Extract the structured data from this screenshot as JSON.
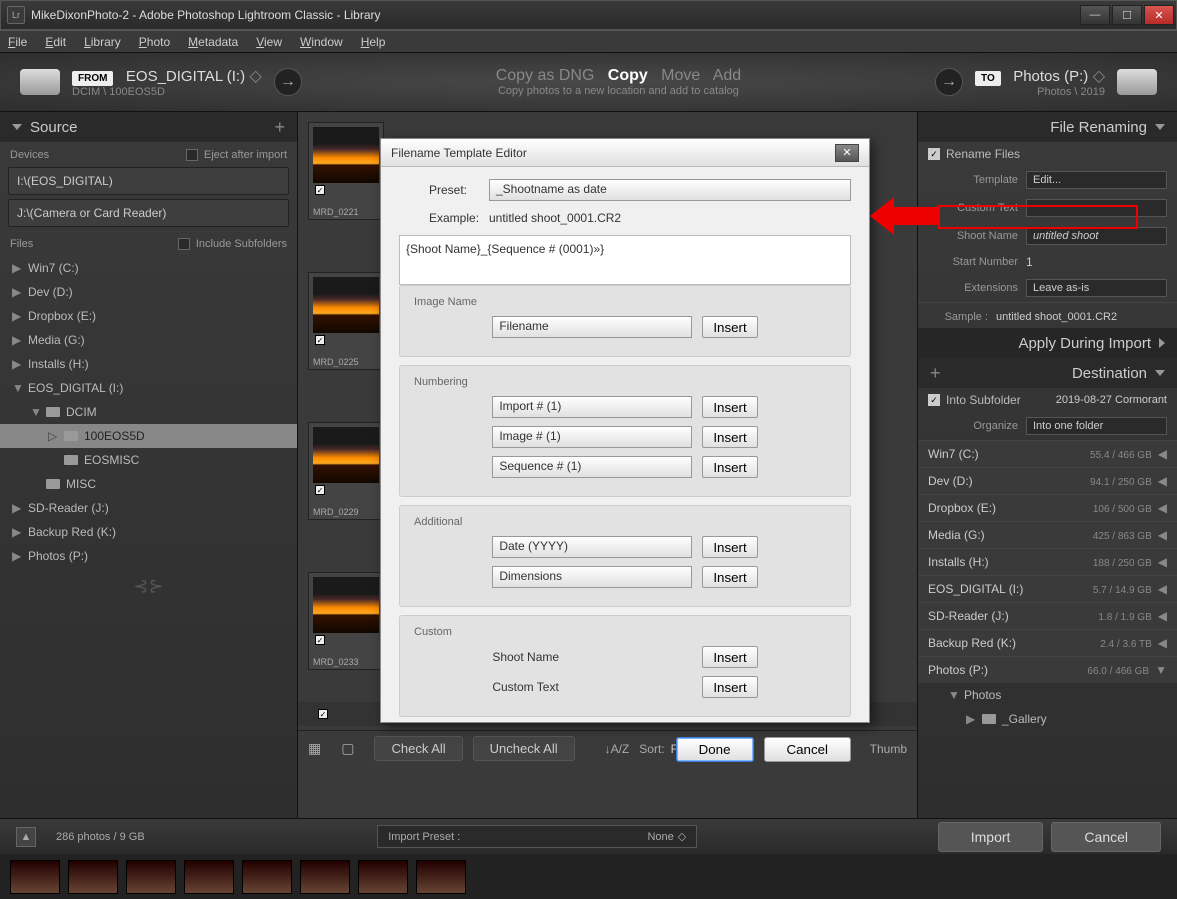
{
  "window": {
    "title": "MikeDixonPhoto-2 - Adobe Photoshop Lightroom Classic - Library"
  },
  "menu": [
    "File",
    "Edit",
    "Library",
    "Photo",
    "Metadata",
    "View",
    "Window",
    "Help"
  ],
  "import": {
    "from_label": "FROM",
    "from_drive": "EOS_DIGITAL (I:)",
    "from_path": "DCIM \\ 100EOS5D",
    "modes": [
      "Copy as DNG",
      "Copy",
      "Move",
      "Add"
    ],
    "desc": "Copy photos to a new location and add to catalog",
    "to_label": "TO",
    "to_drive": "Photos (P:)",
    "to_path": "Photos \\ 2019"
  },
  "source": {
    "header": "Source",
    "devices_label": "Devices",
    "eject": "Eject after import",
    "devices": [
      "I:\\(EOS_DIGITAL)",
      "J:\\(Camera or Card Reader)"
    ],
    "files_label": "Files",
    "include_sub": "Include Subfolders",
    "drives": [
      "Win7 (C:)",
      "Dev (D:)",
      "Dropbox (E:)",
      "Media (G:)",
      "Installs (H:)"
    ],
    "selected_drive": "EOS_DIGITAL (I:)",
    "tree": [
      "DCIM",
      "100EOS5D",
      "EOSMISC",
      "MISC"
    ],
    "drives2": [
      "SD-Reader (J:)",
      "Backup Red (K:)",
      "Photos (P:)"
    ]
  },
  "thumbs": [
    "MRD_0221",
    "MRD_0225",
    "MRD_0229",
    "MRD_0233"
  ],
  "toolbar": {
    "checkall": "Check All",
    "uncheckall": "Uncheck All",
    "sort_label": "Sort:",
    "sort_value": "File Name",
    "thumb": "Thumb"
  },
  "renaming": {
    "header": "File Renaming",
    "rename": "Rename Files",
    "template_label": "Template",
    "template_value": "Edit...",
    "custom_label": "Custom Text",
    "shoot_label": "Shoot Name",
    "shoot_value": "untitled shoot",
    "start_label": "Start Number",
    "start_value": "1",
    "ext_label": "Extensions",
    "ext_value": "Leave as-is",
    "sample_label": "Sample :",
    "sample_value": "untitled shoot_0001.CR2"
  },
  "apply": {
    "header": "Apply During Import"
  },
  "dest": {
    "header": "Destination",
    "into_sub": "Into Subfolder",
    "sub_value": "2019-08-27 Cormorant",
    "org_label": "Organize",
    "org_value": "Into one folder",
    "drives": [
      {
        "name": "Win7 (C:)",
        "size": "55.4 / 466 GB"
      },
      {
        "name": "Dev (D:)",
        "size": "94.1 / 250 GB"
      },
      {
        "name": "Dropbox (E:)",
        "size": "106 / 500 GB"
      },
      {
        "name": "Media (G:)",
        "size": "425 / 863 GB"
      },
      {
        "name": "Installs (H:)",
        "size": "188 / 250 GB"
      },
      {
        "name": "EOS_DIGITAL (I:)",
        "size": "5.7 / 14.9 GB"
      },
      {
        "name": "SD-Reader (J:)",
        "size": "1.8 / 1.9 GB"
      },
      {
        "name": "Backup Red (K:)",
        "size": "2.4 / 3.6 TB"
      },
      {
        "name": "Photos (P:)",
        "size": "66.0 / 466 GB"
      }
    ],
    "tree": [
      "Photos",
      "_Gallery"
    ]
  },
  "footer": {
    "count": "286 photos / 9 GB",
    "preset_label": "Import Preset :",
    "preset_value": "None",
    "import": "Import",
    "cancel": "Cancel"
  },
  "dialog": {
    "title": "Filename Template Editor",
    "preset_label": "Preset:",
    "preset_value": "_Shootname as date",
    "example_label": "Example:",
    "example_value": "untitled shoot_0001.CR2",
    "tokens": "{Shoot Name}_{Sequence # (0001)»}",
    "s_imagename": "Image Name",
    "filename": "Filename",
    "s_numbering": "Numbering",
    "num1": "Import # (1)",
    "num2": "Image # (1)",
    "num3": "Sequence # (1)",
    "s_additional": "Additional",
    "add1": "Date (YYYY)",
    "add2": "Dimensions",
    "s_custom": "Custom",
    "c1": "Shoot Name",
    "c2": "Custom Text",
    "insert": "Insert",
    "done": "Done",
    "cancel": "Cancel"
  }
}
